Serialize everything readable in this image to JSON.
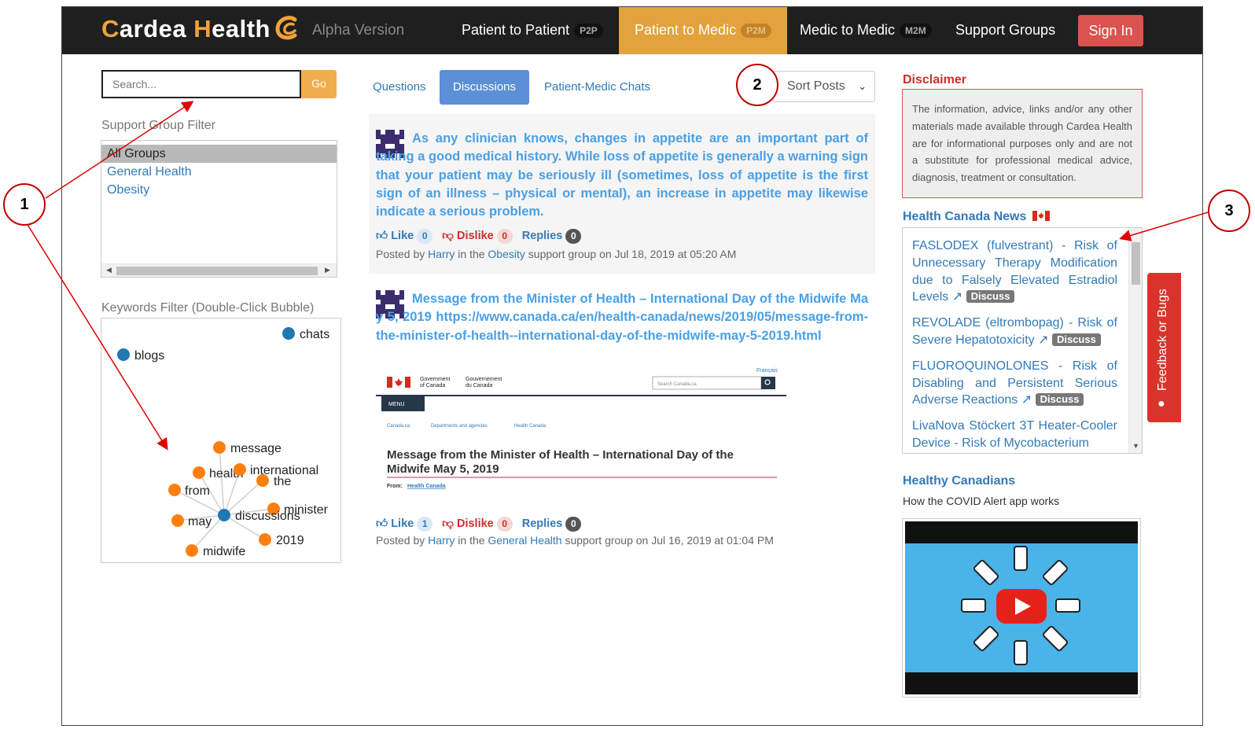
{
  "navbar": {
    "brand": {
      "first": "ardea",
      "first_cap": "C",
      "second": "ealth",
      "second_cap": "H"
    },
    "alpha_label": "Alpha Version",
    "links": [
      {
        "label": "Patient to Patient",
        "badge": "P2P"
      },
      {
        "label": "Patient to Medic",
        "badge": "P2M"
      },
      {
        "label": "Medic to Medic",
        "badge": "M2M"
      },
      {
        "label": "Support Groups"
      }
    ],
    "signin_label": "Sign In",
    "accent_color": "#e2a23c",
    "signin_color": "#d9534f"
  },
  "sidebar": {
    "search": {
      "placeholder": "Search...",
      "button_label": "Go"
    },
    "group_filter_label": "Support Group Filter",
    "groups": [
      "All Groups",
      "General Health",
      "Obesity"
    ],
    "selected_group": "All Groups",
    "keywords_label": "Keywords Filter (Double-Click Bubble)",
    "keywords": {
      "blue": [
        "chats",
        "blogs",
        "discussions"
      ],
      "orange": [
        "message",
        "health",
        "international",
        "the",
        "from",
        "minister",
        "may",
        "2019",
        "midwife"
      ]
    }
  },
  "tabs": {
    "items": [
      "Questions",
      "Discussions",
      "Patient-Medic Chats"
    ],
    "active": "Discussions",
    "sort_label": "Sort Posts"
  },
  "posts": [
    {
      "text": "As any clinician knows, changes in appetite are an important part of taking a good medical history. While loss of appetite is generally a warning sign that your patient may be seriously ill (sometimes, loss of appetite is the first sign of an illness – physical or mental), an increase in appetite may likewise indicate a serious problem.",
      "like_label": "Like",
      "likes": "0",
      "dislike_label": "Dislike",
      "dislikes": "0",
      "replies_label": "Replies",
      "replies": "0",
      "posted_prefix": "Posted by",
      "author": "Harry",
      "in_the": "in the",
      "group": "Obesity",
      "posted_suffix": "support group on Jul 18, 2019 at 05:20 AM"
    },
    {
      "text": "Message from the Minister of Health – International Day of the Midwife May 5, 2019 https://www.canada.ca/en/health-canada/news/2019/05/message-from-the-minister-of-health--international-day-of-the-midwife-may-5-2019.html",
      "like_label": "Like",
      "likes": "1",
      "dislike_label": "Dislike",
      "dislikes": "0",
      "replies_label": "Replies",
      "replies": "0",
      "posted_prefix": "Posted by",
      "author": "Harry",
      "in_the": "in the",
      "group": "General Health",
      "posted_suffix": "support group on Jul 16, 2019 at 01:04 PM",
      "preview": {
        "francais": "Français",
        "gov_en_1": "Government",
        "gov_en_2": "of Canada",
        "gov_fr_1": "Gouvernement",
        "gov_fr_2": "du Canada",
        "search_placeholder": "Search Canada.ca",
        "menu_label": "MENU",
        "crumbs": [
          "Canada.ca",
          "Departments and agencies",
          "Health Canada"
        ],
        "title_line1": "Message from the Minister of Health – International Day of the",
        "title_line2": "Midwife May 5, 2019",
        "from_label": "From:",
        "from_value": "Health Canada"
      }
    }
  ],
  "right": {
    "disclaimer_title": "Disclaimer",
    "disclaimer_text": "The information, advice, links and/or any other materials made available through Cardea Health are for informational purposes only and are not a substitute for professional medical advice, diagnosis, treatment or consultation.",
    "news_title": "Health Canada News",
    "news": [
      {
        "text": "FASLODEX (fulvestrant) - Risk of Unnecessary Therapy Modification due to Falsely Elevated Estradiol Levels",
        "discuss": "Discuss"
      },
      {
        "text": "REVOLADE (eltrombopag) - Risk of Severe Hepatotoxicity",
        "discuss": "Discuss"
      },
      {
        "text": "FLUOROQUINOLONES - Risk of Disabling and Persistent Serious Adverse Reactions",
        "discuss": "Discuss"
      },
      {
        "text": "LivaNova Stöckert 3T Heater-Cooler Device - Risk of Mycobacterium",
        "discuss": ""
      }
    ],
    "healthy_title": "Healthy Canadians",
    "healthy_subtitle": "How the COVID Alert app works",
    "feedback_label": "Feedback or Bugs"
  },
  "annotations": [
    "1",
    "2",
    "3"
  ]
}
